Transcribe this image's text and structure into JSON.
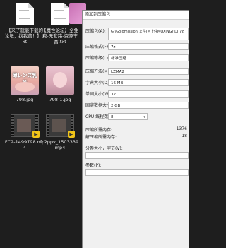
{
  "files": [
    {
      "name": "【来了就能下载的论坛，找我费！】.txt",
      "kind": "txt"
    },
    {
      "name": "【魔性论坛】全免费-无套路-资源丰富.txt",
      "kind": "txt"
    },
    {
      "name": "798.jpg",
      "kind": "jpg",
      "overlay": "薄レンズ乳首"
    },
    {
      "name": "798-1.jpg",
      "kind": "jpg"
    },
    {
      "name": "FC2-1499798.mp4",
      "kind": "mp4"
    },
    {
      "name": "fc2ppv_1503339.mp4",
      "kind": "mp4"
    }
  ],
  "dialog": {
    "title": "添加到压缩包",
    "archive_path_label": "压缩包(A):",
    "archive_path_value": "G:\\Goldmission(文件(M上件MOXING)\\DJ.7z",
    "format_label": "压缩格式(F):",
    "format_value": "7z",
    "level_label": "压缩等级(L):",
    "level_value": "标准压缩",
    "method_label": "压缩方法(M):",
    "method_value": "LZMA2",
    "dict_label": "字典大小(D):",
    "dict_value": "16 MB",
    "word_label": "单词大小(W):",
    "word_value": "32",
    "solid_label": "固实数据大小:",
    "solid_value": "2 GB",
    "threads_label": "CPU 线程数:",
    "threads_value": "8",
    "mem_compress_label": "压缩所需内存:",
    "mem_compress_value": "1376",
    "mem_decompress_label": "解压缩所需内存:",
    "mem_decompress_value": "18",
    "split_label": "分卷大小，字节(V):",
    "params_label": "参数(P):"
  }
}
